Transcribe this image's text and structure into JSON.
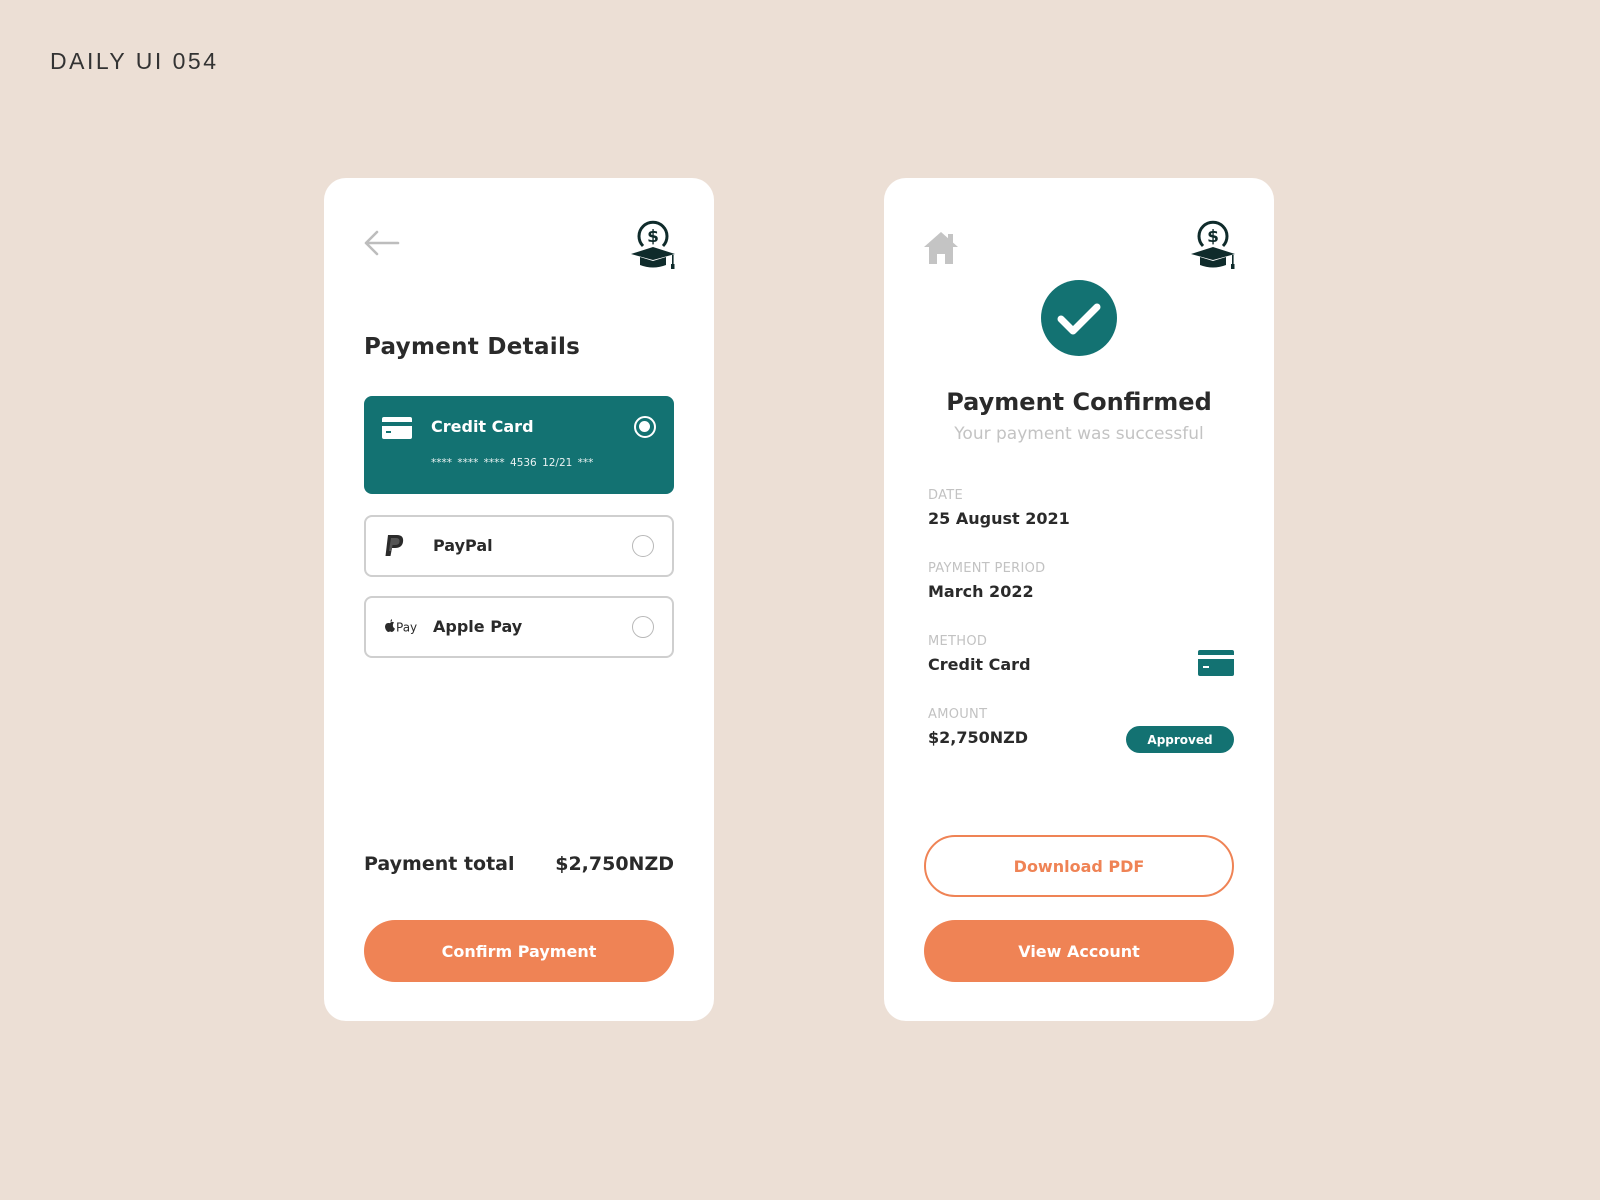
{
  "page_label": "DAILY UI 054",
  "colors": {
    "background": "#ecdfd5",
    "teal": "#137272",
    "orange": "#ef8355",
    "dark_icon": "#0f2b2b"
  },
  "payment_screen": {
    "back_icon": "arrow-left-icon",
    "brand_icon": "graduation-cap-dollar-icon",
    "title": "Payment Details",
    "methods": [
      {
        "label": "Credit Card",
        "icon": "credit-card-icon",
        "details": "**** **** **** 4536   12/21   ***",
        "selected": true
      },
      {
        "label": "PayPal",
        "icon": "paypal-icon",
        "selected": false
      },
      {
        "label": "Apple Pay",
        "icon": "apple-pay-icon",
        "icon_text": "Pay",
        "selected": false
      }
    ],
    "total_label": "Payment total",
    "total_value": "$2,750NZD",
    "confirm_button": "Confirm Payment"
  },
  "confirmation_screen": {
    "home_icon": "home-icon",
    "brand_icon": "graduation-cap-dollar-icon",
    "status_icon": "check-circle-icon",
    "title": "Payment Confirmed",
    "subtitle": "Your payment was successful",
    "details": {
      "date": {
        "label": "DATE",
        "value": "25 August 2021"
      },
      "period": {
        "label": "PAYMENT PERIOD",
        "value": "March 2022"
      },
      "method": {
        "label": "METHOD",
        "value": "Credit Card",
        "icon": "credit-card-icon"
      },
      "amount": {
        "label": "AMOUNT",
        "value": "$2,750NZD",
        "badge": "Approved"
      }
    },
    "download_button": "Download PDF",
    "view_account_button": "View Account"
  }
}
